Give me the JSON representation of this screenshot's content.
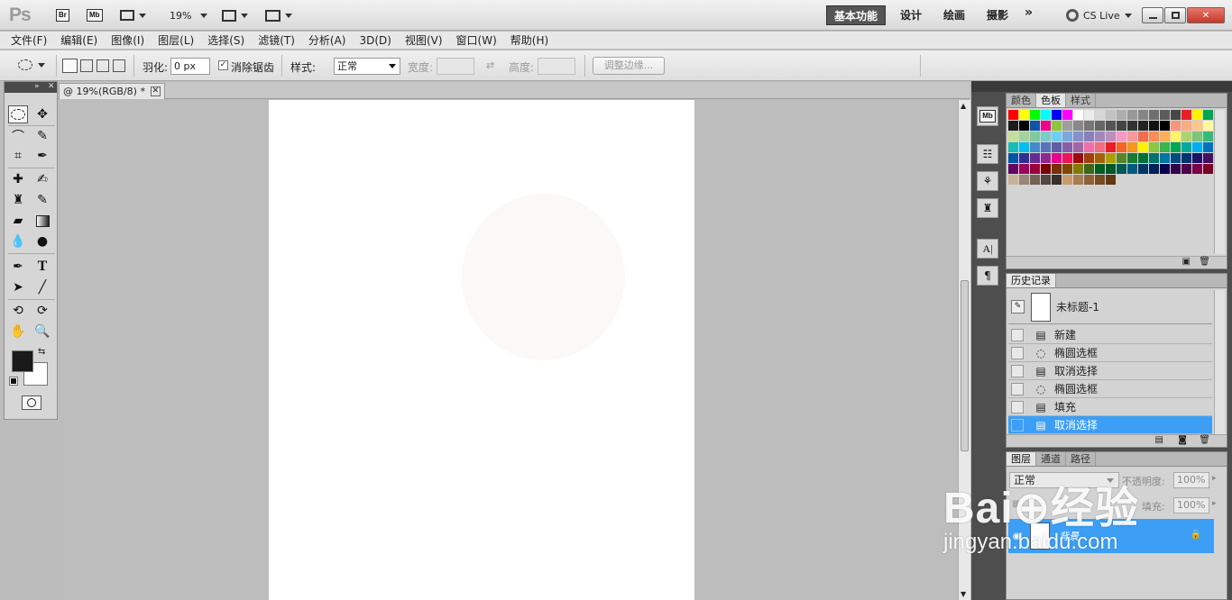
{
  "app": {
    "logo": "Ps",
    "bridge": "Br",
    "minibridge": "Mb",
    "zoom": "19%",
    "workspaces": [
      "基本功能",
      "设计",
      "绘画",
      "摄影"
    ],
    "more": "»",
    "cslive": "CS Live"
  },
  "menu": [
    "文件(F)",
    "编辑(E)",
    "图像(I)",
    "图层(L)",
    "选择(S)",
    "滤镜(T)",
    "分析(A)",
    "3D(D)",
    "视图(V)",
    "窗口(W)",
    "帮助(H)"
  ],
  "options": {
    "feather_label": "羽化:",
    "feather_value": "0 px",
    "antialias_label": "消除锯齿",
    "style_label": "样式:",
    "style_value": "正常",
    "width_label": "宽度:",
    "height_label": "高度:",
    "refine_edge": "调整边缘..."
  },
  "document": {
    "tab_title": "@ 19%(RGB/8) *"
  },
  "panels": {
    "swatches_tabs": [
      "颜色",
      "色板",
      "样式"
    ],
    "history_tab": "历史记录",
    "history_snapshot": "未标题-1",
    "history_items": [
      {
        "label": "新建",
        "icon": "document-icon"
      },
      {
        "label": "椭圆选框",
        "icon": "ellipse-icon"
      },
      {
        "label": "取消选择",
        "icon": "document-icon"
      },
      {
        "label": "椭圆选框",
        "icon": "ellipse-icon"
      },
      {
        "label": "填充",
        "icon": "fill-icon"
      },
      {
        "label": "取消选择",
        "icon": "document-icon",
        "selected": true
      }
    ],
    "layers_tabs": [
      "图层",
      "通道",
      "路径"
    ],
    "blend_mode": "正常",
    "opacity_label": "不透明度:",
    "opacity_value": "100%",
    "fill_label": "填充:",
    "fill_value": "100%",
    "layer_name": "背景"
  },
  "colors": {
    "accent": "#3c9ff5",
    "foreground": "#1a1a1a",
    "background": "#ffffff",
    "swatches": [
      "#ff0000",
      "#ffff00",
      "#00ff00",
      "#00ffff",
      "#0000ff",
      "#ff00ff",
      "#ffffff",
      "#ebebeb",
      "#d6d6d6",
      "#c2c2c2",
      "#adadad",
      "#999999",
      "#858585",
      "#707070",
      "#5c5c5c",
      "#474747",
      "#ed1c24",
      "#fff200",
      "#00a651",
      "#1c1c1c",
      "#000000",
      "#0b58a8",
      "#ec008c",
      "#8dc63f",
      "#9e9e9e",
      "#888888",
      "#777777",
      "#666666",
      "#555555",
      "#444444",
      "#333333",
      "#222222",
      "#111111",
      "#000000",
      "#f7977a",
      "#f9ad81",
      "#fdc68a",
      "#fff79a",
      "#c4df9b",
      "#a3d39c",
      "#82ca9c",
      "#7accc8",
      "#6dcff6",
      "#7da7d9",
      "#8393ca",
      "#8781bd",
      "#a187be",
      "#bc8dbf",
      "#f49ac2",
      "#f6989d",
      "#f26c4f",
      "#f68e55",
      "#fbaf5c",
      "#fff467",
      "#acd372",
      "#7cc576",
      "#3bb878",
      "#1abbb4",
      "#00bff3",
      "#438ccb",
      "#5574b9",
      "#605ca8",
      "#855fa8",
      "#a763a8",
      "#f06eaa",
      "#f26d7d",
      "#ed1c24",
      "#f26522",
      "#f7941d",
      "#fff200",
      "#8dc63f",
      "#39b54a",
      "#00a651",
      "#00a99d",
      "#00aeef",
      "#0072bc",
      "#0054a6",
      "#2e3192",
      "#662d91",
      "#92278f",
      "#ec008c",
      "#ed145b",
      "#9e0b0f",
      "#a0410d",
      "#a36209",
      "#aba000",
      "#598527",
      "#197b30",
      "#007236",
      "#00746b",
      "#0076a3",
      "#004b80",
      "#003471",
      "#1b1464",
      "#440e62",
      "#630460",
      "#9e005d",
      "#9e0039",
      "#790000",
      "#7b2e00",
      "#7d4900",
      "#827b00",
      "#406618",
      "#005e20",
      "#005826",
      "#005952",
      "#005b7f",
      "#003663",
      "#002157",
      "#0d004c",
      "#32004b",
      "#4b0049",
      "#7b0046",
      "#7a0026",
      "#c7b299",
      "#998675",
      "#736357",
      "#534741",
      "#37302d",
      "#c69c6d",
      "#a67c52",
      "#8c6239",
      "#754c24",
      "#603913"
    ]
  },
  "watermark": {
    "brand": "Bai⊕经验",
    "url": "jingyan.baidu.com"
  }
}
